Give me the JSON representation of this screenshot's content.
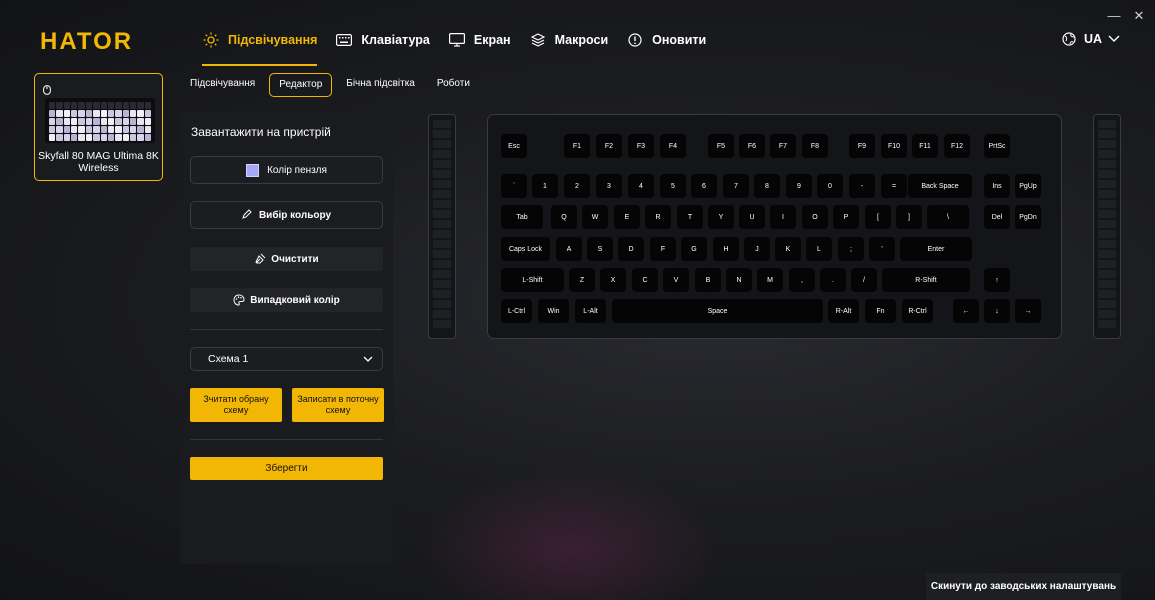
{
  "app": {
    "logo": "HATOR"
  },
  "window": {
    "minimize": "—",
    "close": "✕"
  },
  "nav": {
    "items": [
      {
        "label": "Підсвічування",
        "icon": "sun-icon",
        "active": true
      },
      {
        "label": "Клавіатура",
        "icon": "keyboard-icon",
        "active": false
      },
      {
        "label": "Екран",
        "icon": "monitor-icon",
        "active": false
      },
      {
        "label": "Макроси",
        "icon": "layers-icon",
        "active": false
      },
      {
        "label": "Оновити",
        "icon": "info-circle-icon",
        "active": false
      }
    ],
    "language": "UA"
  },
  "device": {
    "name": "Skyfall 80 MAG Ultima 8K Wireless",
    "icon": "mouse-icon"
  },
  "subtabs": [
    {
      "label": "Підсвічування",
      "active": false
    },
    {
      "label": "Редактор",
      "active": true
    },
    {
      "label": "Бічна підсвітка",
      "active": false
    },
    {
      "label": "Роботи",
      "active": false
    }
  ],
  "panel": {
    "title": "Завантажити на пристрій",
    "brush_color_label": "Колір пензля",
    "brush_color": "#a5a8f5",
    "pick_color_label": "Вибір кольору",
    "clear_label": "Очистити",
    "random_color_label": "Випадковий колір",
    "scheme_selected": "Схема 1",
    "read_scheme_label": "Зчитати обрану схему",
    "write_scheme_label": "Записати в поточну схему",
    "save_label": "Зберегти"
  },
  "keyboard": {
    "rows": [
      [
        "Esc",
        "F1",
        "F2",
        "F3",
        "F4",
        "F5",
        "F6",
        "F7",
        "F8",
        "F9",
        "F10",
        "F11",
        "F12",
        "PrtSc"
      ],
      [
        "`",
        "1",
        "2",
        "3",
        "4",
        "5",
        "6",
        "7",
        "8",
        "9",
        "0",
        "-",
        "=",
        "Back Space",
        "Ins",
        "PgUp"
      ],
      [
        "Tab",
        "Q",
        "W",
        "E",
        "R",
        "T",
        "Y",
        "U",
        "I",
        "O",
        "P",
        "[",
        "]",
        "\\",
        "Del",
        "PgDn"
      ],
      [
        "Caps Lock",
        "A",
        "S",
        "D",
        "F",
        "G",
        "H",
        "J",
        "K",
        "L",
        ";",
        "'",
        "Enter"
      ],
      [
        "L-Shift",
        "Z",
        "X",
        "C",
        "V",
        "B",
        "N",
        "M",
        ",",
        ".",
        "/",
        "R-Shift",
        "↑"
      ],
      [
        "L-Ctrl",
        "Win",
        "L-Alt",
        "Space",
        "R-Alt",
        "Fn",
        "R-Ctrl",
        "←",
        "↓",
        "→"
      ]
    ]
  },
  "footer": {
    "reset_label": "Скинути до заводських налаштувань"
  },
  "colors": {
    "accent": "#f2b705",
    "background": "#1c1d21",
    "key": "#050506"
  }
}
